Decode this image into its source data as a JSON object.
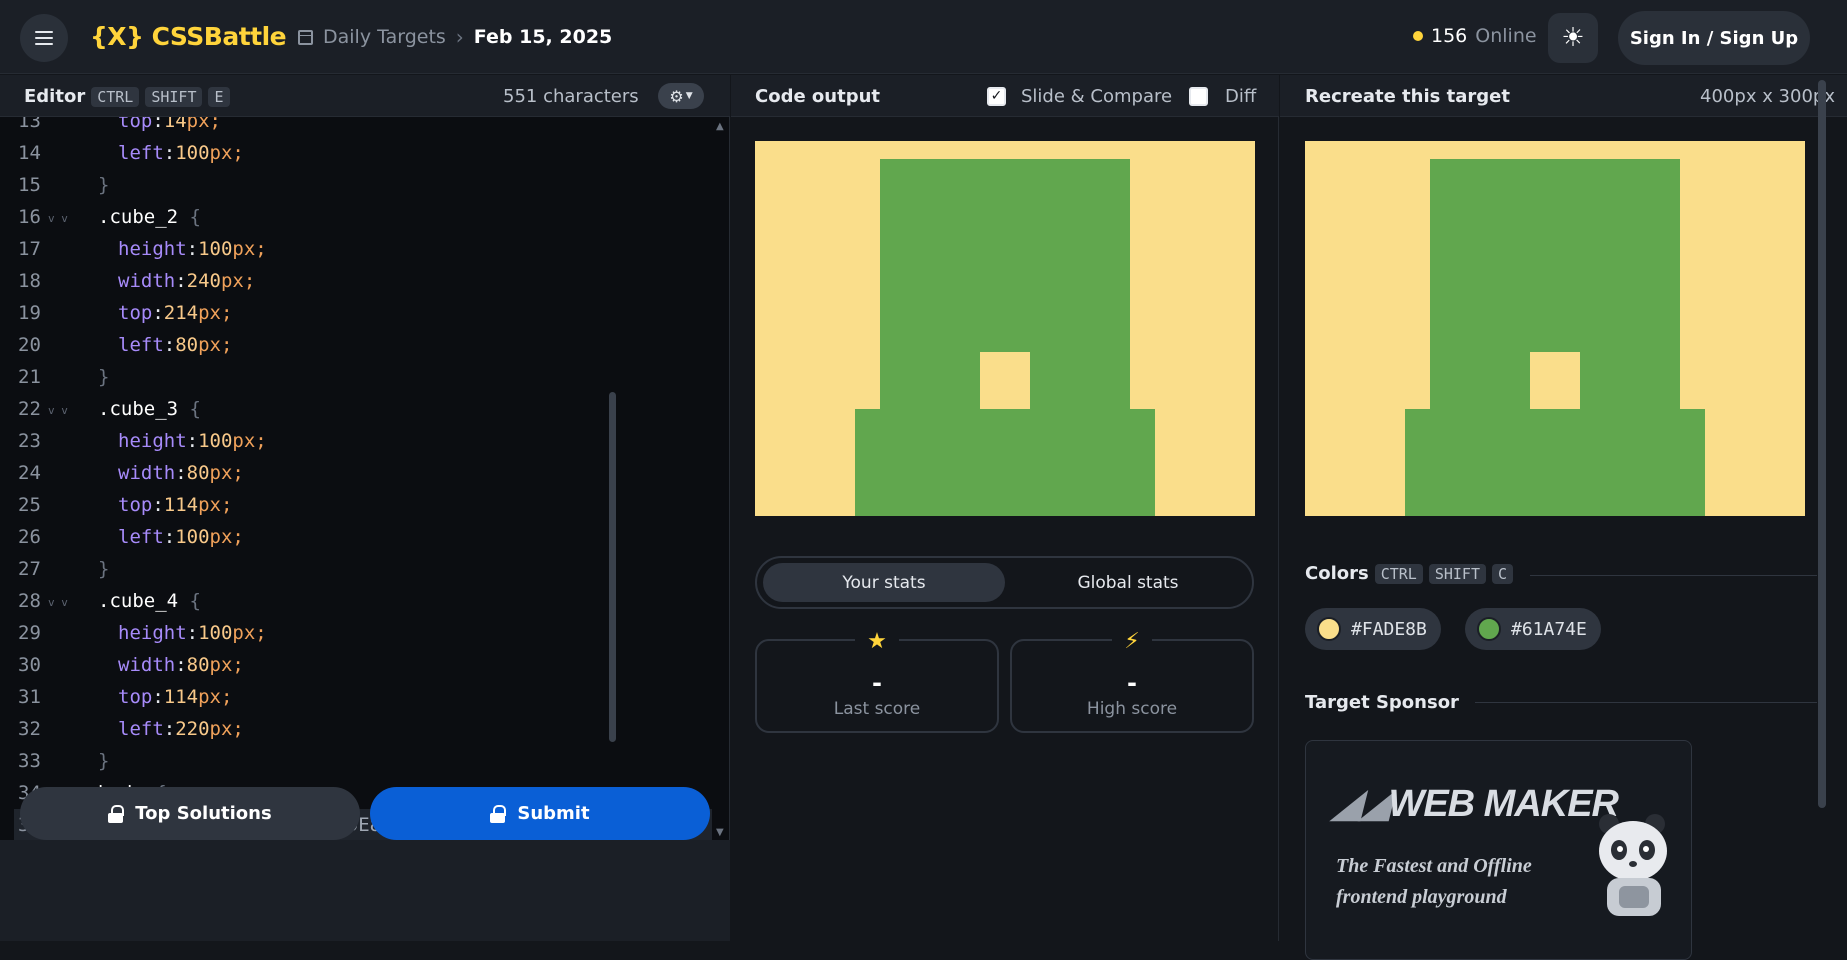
{
  "header": {
    "logo": "{X} CSSBattle",
    "breadcrumb_root": "Daily Targets",
    "breadcrumb_date": "Feb 15, 2025",
    "online_count": "156",
    "online_label": "Online",
    "signin_label": "Sign In / Sign Up"
  },
  "editor": {
    "title": "Editor",
    "shortcut": [
      "CTRL",
      "SHIFT",
      "E"
    ],
    "char_count": "551 characters",
    "top_solutions_label": "Top Solutions",
    "submit_label": "Submit",
    "lines": [
      {
        "n": "13",
        "indent": 2,
        "tokens": [
          [
            "prop",
            "top"
          ],
          [
            "colon",
            ":"
          ],
          [
            "num",
            "14"
          ],
          [
            "unit",
            "px;"
          ]
        ]
      },
      {
        "n": "14",
        "indent": 2,
        "tokens": [
          [
            "prop",
            "left"
          ],
          [
            "colon",
            ":"
          ],
          [
            "num",
            "100"
          ],
          [
            "unit",
            "px;"
          ]
        ]
      },
      {
        "n": "15",
        "indent": 1,
        "tokens": [
          [
            "brace",
            "}"
          ]
        ]
      },
      {
        "n": "16",
        "indent": 1,
        "fold": true,
        "tokens": [
          [
            "sel",
            ".cube_2 "
          ],
          [
            "brace",
            "{"
          ]
        ]
      },
      {
        "n": "17",
        "indent": 2,
        "tokens": [
          [
            "prop",
            "height"
          ],
          [
            "colon",
            ":"
          ],
          [
            "num",
            "100"
          ],
          [
            "unit",
            "px;"
          ]
        ]
      },
      {
        "n": "18",
        "indent": 2,
        "tokens": [
          [
            "prop",
            "width"
          ],
          [
            "colon",
            ":"
          ],
          [
            "num",
            "240"
          ],
          [
            "unit",
            "px;"
          ]
        ]
      },
      {
        "n": "19",
        "indent": 2,
        "tokens": [
          [
            "prop",
            "top"
          ],
          [
            "colon",
            ":"
          ],
          [
            "num",
            "214"
          ],
          [
            "unit",
            "px;"
          ]
        ]
      },
      {
        "n": "20",
        "indent": 2,
        "tokens": [
          [
            "prop",
            "left"
          ],
          [
            "colon",
            ":"
          ],
          [
            "num",
            "80"
          ],
          [
            "unit",
            "px;"
          ]
        ]
      },
      {
        "n": "21",
        "indent": 1,
        "tokens": [
          [
            "brace",
            "}"
          ]
        ]
      },
      {
        "n": "22",
        "indent": 1,
        "fold": true,
        "tokens": [
          [
            "sel",
            ".cube_3 "
          ],
          [
            "brace",
            "{"
          ]
        ]
      },
      {
        "n": "23",
        "indent": 2,
        "tokens": [
          [
            "prop",
            "height"
          ],
          [
            "colon",
            ":"
          ],
          [
            "num",
            "100"
          ],
          [
            "unit",
            "px;"
          ]
        ]
      },
      {
        "n": "24",
        "indent": 2,
        "tokens": [
          [
            "prop",
            "width"
          ],
          [
            "colon",
            ":"
          ],
          [
            "num",
            "80"
          ],
          [
            "unit",
            "px;"
          ]
        ]
      },
      {
        "n": "25",
        "indent": 2,
        "tokens": [
          [
            "prop",
            "top"
          ],
          [
            "colon",
            ":"
          ],
          [
            "num",
            "114"
          ],
          [
            "unit",
            "px;"
          ]
        ]
      },
      {
        "n": "26",
        "indent": 2,
        "tokens": [
          [
            "prop",
            "left"
          ],
          [
            "colon",
            ":"
          ],
          [
            "num",
            "100"
          ],
          [
            "unit",
            "px;"
          ]
        ]
      },
      {
        "n": "27",
        "indent": 1,
        "tokens": [
          [
            "brace",
            "}"
          ]
        ]
      },
      {
        "n": "28",
        "indent": 1,
        "fold": true,
        "tokens": [
          [
            "sel",
            ".cube_4 "
          ],
          [
            "brace",
            "{"
          ]
        ]
      },
      {
        "n": "29",
        "indent": 2,
        "tokens": [
          [
            "prop",
            "height"
          ],
          [
            "colon",
            ":"
          ],
          [
            "num",
            "100"
          ],
          [
            "unit",
            "px;"
          ]
        ]
      },
      {
        "n": "30",
        "indent": 2,
        "tokens": [
          [
            "prop",
            "width"
          ],
          [
            "colon",
            ":"
          ],
          [
            "num",
            "80"
          ],
          [
            "unit",
            "px;"
          ]
        ]
      },
      {
        "n": "31",
        "indent": 2,
        "tokens": [
          [
            "prop",
            "top"
          ],
          [
            "colon",
            ":"
          ],
          [
            "num",
            "114"
          ],
          [
            "unit",
            "px;"
          ]
        ]
      },
      {
        "n": "32",
        "indent": 2,
        "tokens": [
          [
            "prop",
            "left"
          ],
          [
            "colon",
            ":"
          ],
          [
            "num",
            "220"
          ],
          [
            "unit",
            "px;"
          ]
        ]
      },
      {
        "n": "33",
        "indent": 1,
        "tokens": [
          [
            "brace",
            "}"
          ]
        ]
      },
      {
        "n": "34",
        "indent": 1,
        "fold": true,
        "tokens": [
          [
            "sel",
            "body "
          ],
          [
            "brace",
            "{"
          ]
        ]
      },
      {
        "n": "35",
        "indent": 2,
        "active": true,
        "tokens": [
          [
            "prop",
            "background-color"
          ],
          [
            "colon",
            ":"
          ],
          [
            "hex",
            "#FADE8B"
          ],
          [
            "unit",
            ";"
          ]
        ]
      }
    ]
  },
  "output": {
    "title": "Code output",
    "slide_compare_label": "Slide & Compare",
    "slide_compare_checked": true,
    "diff_label": "Diff",
    "diff_checked": false,
    "tab_your_stats": "Your stats",
    "tab_global_stats": "Global stats",
    "last_score_value": "-",
    "last_score_label": "Last score",
    "high_score_value": "-",
    "high_score_label": "High score"
  },
  "target": {
    "title": "Recreate this target",
    "size": "400px x 300px",
    "colors_title": "Colors",
    "colors_shortcut": [
      "CTRL",
      "SHIFT",
      "C"
    ],
    "colors": [
      {
        "hex": "#FADE8B"
      },
      {
        "hex": "#61A74E"
      }
    ],
    "sponsor_title": "Target Sponsor",
    "sponsor_logo": "WEB MAKER",
    "sponsor_tagline_1": "The Fastest and Offline",
    "sponsor_tagline_2": "frontend playground"
  },
  "colors": {
    "bg_color": "#FADE8B",
    "shape_color": "#61A74E",
    "accent": "#ffd43b",
    "submit_blue": "#0a5fd6"
  }
}
